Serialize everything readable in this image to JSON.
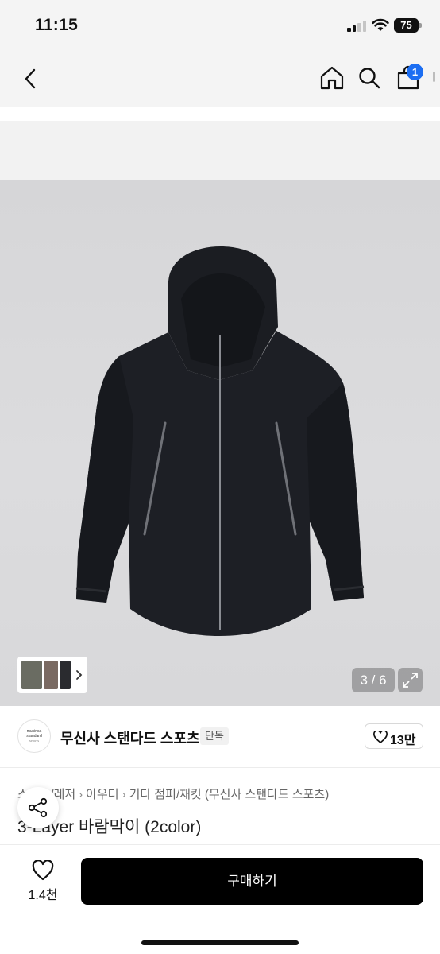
{
  "status": {
    "time": "11:15",
    "battery": "75"
  },
  "nav": {
    "cart_count": "1"
  },
  "gallery": {
    "counter": "3 / 6"
  },
  "brand": {
    "logo_text_line1": "musinsa",
    "logo_text_line2": "standard",
    "logo_text_line3": "SPORTS",
    "name": "무신사 스탠다드 스포츠",
    "badge": "단독",
    "like_count": "13만"
  },
  "breadcrumb": {
    "items": [
      "스포츠/레저",
      "아우터",
      "기타 점퍼/재킷",
      "(무신사 스탠다드 스포츠)"
    ]
  },
  "product": {
    "title": "3-Layer 바람막이 (2color)"
  },
  "bottom_bar": {
    "wish_count": "1.4천",
    "buy_label": "구매하기"
  },
  "colors": {
    "accent_badge": "#1c6ef2",
    "buy_button": "#000000"
  }
}
